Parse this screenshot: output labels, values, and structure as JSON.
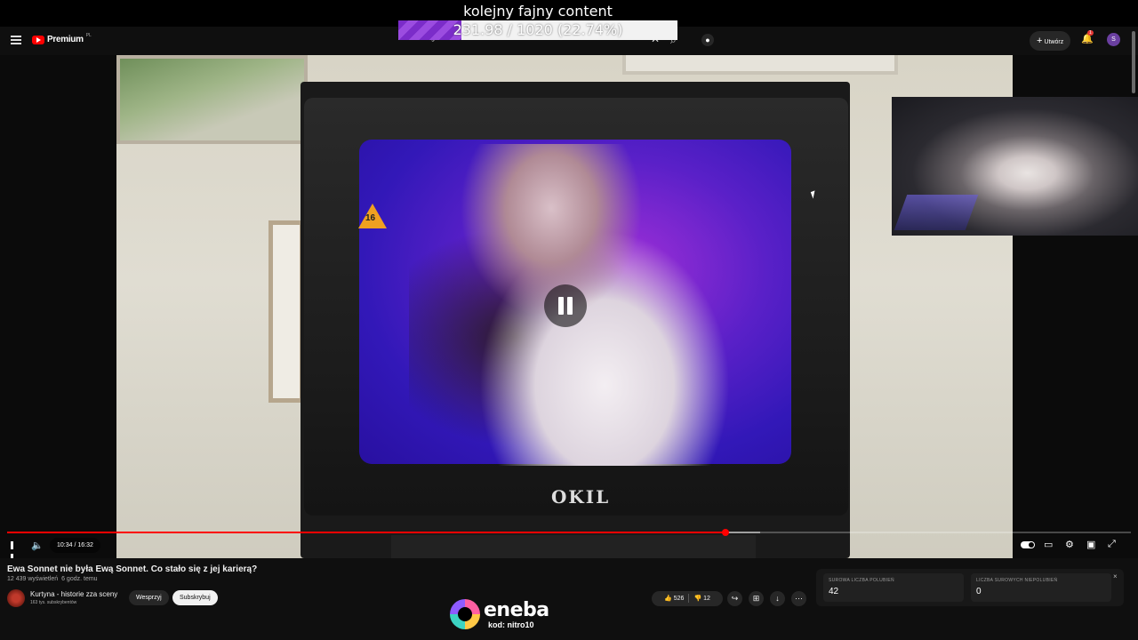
{
  "overlay": {
    "title": "kolejny fajny content",
    "goal_text": "231.98 / 1020 (22.74%)",
    "goal_progress": 0.2274
  },
  "header": {
    "logo_label": "Premium",
    "logo_region": "PL",
    "search_value": "globalista",
    "create_label": "Utwórz",
    "notification_count": "1",
    "avatar_letter": "S"
  },
  "player": {
    "current_time": "10:34",
    "duration": "16:32",
    "time_display": "10:34 / 16:32",
    "played_fraction": 0.639,
    "buffered_fraction": 0.67,
    "age_rating": "16",
    "tv_brand": "OKIL"
  },
  "video": {
    "title": "Ewa Sonnet nie była Ewą Sonnet. Co stało się z jej karierą?",
    "views": "12 439 wyświetleń",
    "uploaded": "6 godz. temu",
    "channel_name": "Kurtyna - historie zza sceny",
    "channel_subs": "163 tys. subskrybentów",
    "support_label": "Wesprzyj",
    "subscribe_label": "Subskrybuj",
    "likes": "526",
    "dislikes": "12"
  },
  "stats": {
    "likes_label": "SUROWA LICZBA POLUBIEŃ",
    "likes_value": "42",
    "dislikes_label": "LICZBA SUROWYCH NIEPOLUBIEŃ",
    "dislikes_value": "0"
  },
  "sponsor": {
    "name": "eneba",
    "code": "kod: nitro10"
  },
  "icons": {
    "menu": "menu-icon",
    "youtube": "youtube-logo-icon",
    "close": "close-icon",
    "search": "search-icon",
    "mic": "mic-icon",
    "bell": "bell-icon",
    "pause": "pause-icon",
    "volume": "volume-icon",
    "autoplay": "autoplay-toggle-icon",
    "subtitles": "subtitles-icon",
    "settings": "settings-icon",
    "miniplayer": "miniplayer-icon",
    "fullscreen": "fullscreen-icon",
    "like": "thumbs-up-icon",
    "dislike": "thumbs-down-icon",
    "share": "share-icon",
    "save": "save-icon",
    "download": "download-icon",
    "more": "more-icon"
  },
  "colors": {
    "accent": "#ff0000",
    "goal_fill": "#7b2cc9",
    "background": "#0f0f0f"
  }
}
